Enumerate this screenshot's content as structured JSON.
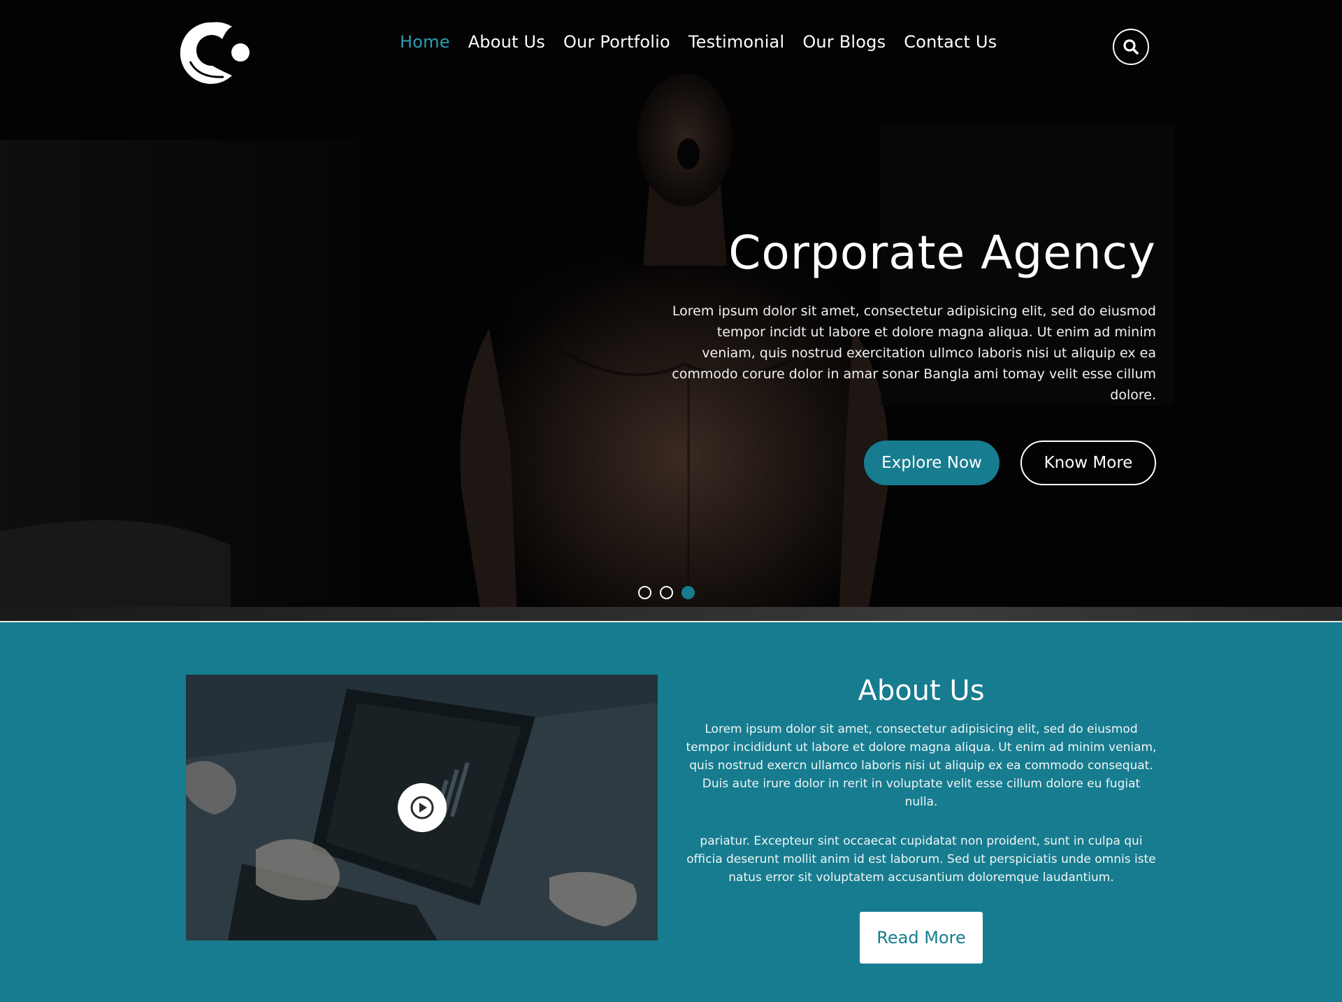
{
  "nav": {
    "items": [
      {
        "label": "Home",
        "active": true
      },
      {
        "label": "About Us",
        "active": false
      },
      {
        "label": "Our Portfolio",
        "active": false
      },
      {
        "label": "Testimonial",
        "active": false
      },
      {
        "label": "Our Blogs",
        "active": false
      },
      {
        "label": "Contact Us",
        "active": false
      }
    ],
    "search_icon": "search-icon"
  },
  "hero": {
    "title": "Corporate Agency",
    "description": "Lorem ipsum dolor sit amet, consectetur adipisicing elit, sed do eiusmod tempor incidt ut labore et dolore magna aliqua. Ut enim ad minim veniam, quis nostrud exercitation ullmco laboris nisi ut aliquip ex ea commodo corure dolor in amar sonar Bangla ami tomay velit esse cillum dolore.",
    "primary_button": "Explore Now",
    "secondary_button": "Know More",
    "slides": 3,
    "active_slide": 3
  },
  "about": {
    "title": "About Us",
    "paragraph1": "Lorem ipsum dolor sit amet, consectetur adipisicing elit, sed do eiusmod tempor incididunt ut labore et dolore magna aliqua. Ut enim ad minim veniam, quis nostrud exercn ullamco laboris nisi ut aliquip ex ea commodo consequat. Duis aute irure dolor in rerit in voluptate velit esse cillum dolore eu fugiat nulla.",
    "paragraph2": "pariatur. Excepteur sint occaecat cupidatat non proident, sunt in culpa qui officia deserunt mollit anim id est laborum. Sed ut perspiciatis unde omnis iste natus error sit voluptatem accusantium doloremque laudantium.",
    "button": "Read More",
    "media_icon": "play-icon"
  },
  "colors": {
    "accent": "#177c8f",
    "nav_active": "#2f9cb0",
    "hero_bg": "#030303"
  }
}
